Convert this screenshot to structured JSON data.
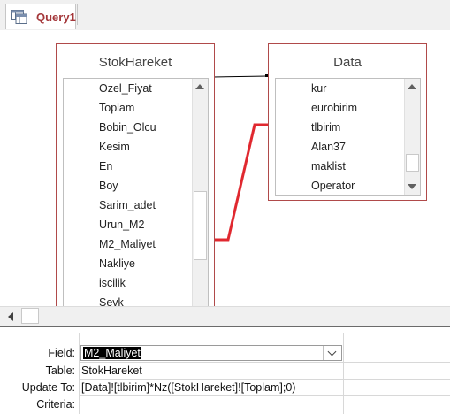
{
  "tab": {
    "title": "Query1",
    "icon": "query-icon"
  },
  "tables": [
    {
      "title": "StokHareket",
      "fields": [
        "Ozel_Fiyat",
        "Toplam",
        "Bobin_Olcu",
        "Kesim",
        "En",
        "Boy",
        "Sarim_adet",
        "Urun_M2",
        "M2_Maliyet",
        "Nakliye",
        "iscilik",
        "Sevk"
      ]
    },
    {
      "title": "Data",
      "fields": [
        "kur",
        "eurobirim",
        "tlbirim",
        "Alan37",
        "maklist",
        "Operator"
      ]
    }
  ],
  "grid": {
    "labels": {
      "field": "Field:",
      "table": "Table:",
      "update_to": "Update To:",
      "criteria": "Criteria:"
    },
    "field_value": "M2_Maliyet",
    "table_value": "StokHareket",
    "update_to_value": "[Data]![tlbirim]*Nz([StokHareket]![Toplam];0)",
    "criteria_value": ""
  },
  "colors": {
    "tab_text": "#a4373a",
    "relationship_line": "#e0282f",
    "table_border": "#b04a4a"
  }
}
